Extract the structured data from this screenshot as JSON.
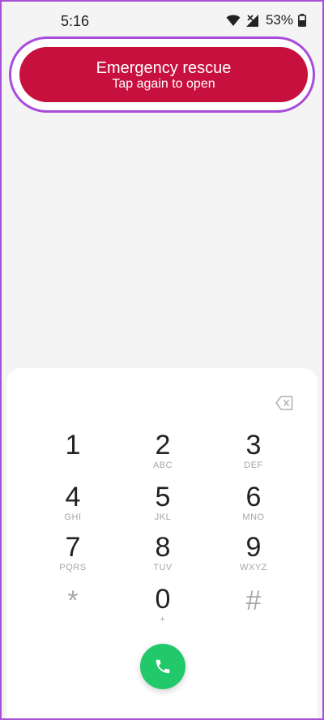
{
  "status_bar": {
    "time": "5:16",
    "battery": "53%"
  },
  "emergency": {
    "title": "Emergency rescue",
    "subtitle": "Tap again to open",
    "color": "#c8103e"
  },
  "dialpad": {
    "keys": [
      {
        "digit": "1",
        "letters": ""
      },
      {
        "digit": "2",
        "letters": "ABC"
      },
      {
        "digit": "3",
        "letters": "DEF"
      },
      {
        "digit": "4",
        "letters": "GHI"
      },
      {
        "digit": "5",
        "letters": "JKL"
      },
      {
        "digit": "6",
        "letters": "MNO"
      },
      {
        "digit": "7",
        "letters": "PQRS"
      },
      {
        "digit": "8",
        "letters": "TUV"
      },
      {
        "digit": "9",
        "letters": "WXYZ"
      },
      {
        "digit": "*",
        "letters": ""
      },
      {
        "digit": "0",
        "letters": "+"
      },
      {
        "digit": "#",
        "letters": ""
      }
    ],
    "call_color": "#22c96a"
  }
}
